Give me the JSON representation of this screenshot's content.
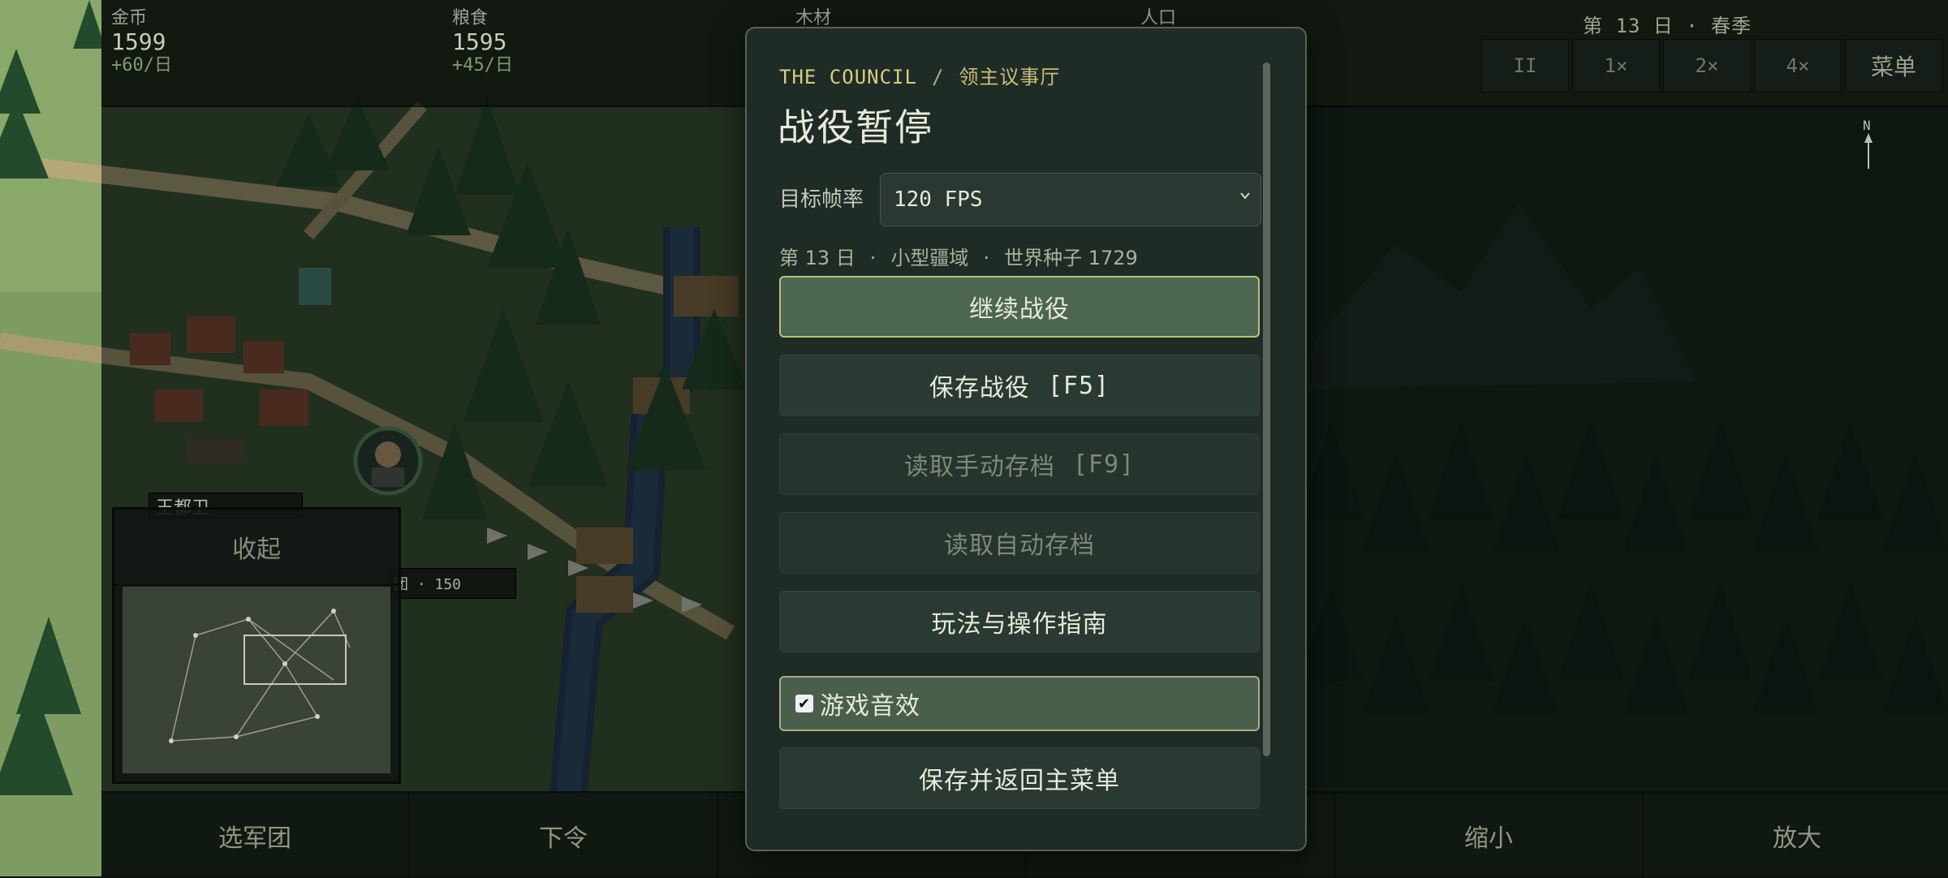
{
  "hud": {
    "gold": {
      "label": "金币",
      "value": "1599",
      "rate": "+60/日"
    },
    "food": {
      "label": "粮食",
      "value": "1595",
      "rate": "+45/日"
    },
    "wood": {
      "label": "木材"
    },
    "population": {
      "label": "人口"
    },
    "day": "第 13 日 · 春季",
    "speed_buttons": [
      "II",
      "1×",
      "2×",
      "4×"
    ],
    "menu": "菜单"
  },
  "bottom_bar": {
    "buttons": [
      "选军团",
      "下令",
      "",
      "",
      "缩小",
      "放大"
    ]
  },
  "minimap": {
    "collapse": "收起"
  },
  "map": {
    "army_name": "王都卫",
    "army_info": "团 · 150",
    "compass": "N"
  },
  "modal": {
    "breadcrumb_en": "THE COUNCIL",
    "breadcrumb_sep": "/",
    "breadcrumb_cn": "领主议事厅",
    "title": "战役暂停",
    "fps_label": "目标帧率",
    "fps_value": "120 FPS",
    "meta": {
      "day": "第 13 日",
      "size": "小型疆域",
      "seed": "世界种子 1729",
      "dot": "·"
    },
    "buttons": {
      "resume": "继续战役",
      "save": "保存战役",
      "save_key": "[F5]",
      "load_manual": "读取手动存档",
      "load_manual_key": "[F9]",
      "load_auto": "读取自动存档",
      "guide": "玩法与操作指南",
      "sound": "游戏音效",
      "save_exit": "保存并返回主菜单"
    },
    "sound_enabled": true
  },
  "colors": {
    "accent": "#b9c27a",
    "panel": "#1f2b25",
    "button": "#2a3a32",
    "primary_button": "#4d6651"
  }
}
